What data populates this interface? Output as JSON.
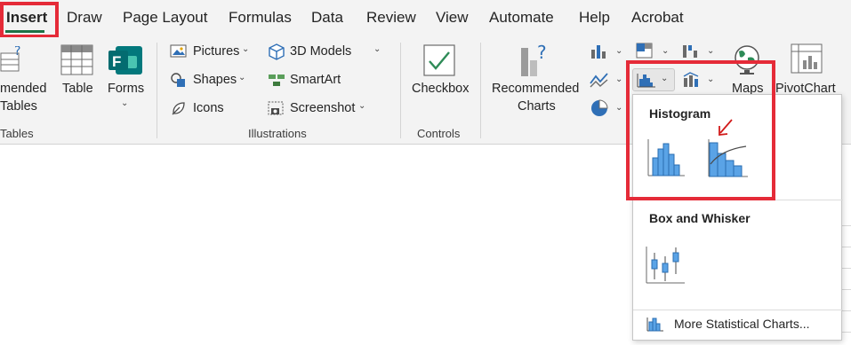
{
  "tabs": [
    {
      "label": "Insert"
    },
    {
      "label": "Draw"
    },
    {
      "label": "Page Layout"
    },
    {
      "label": "Formulas"
    },
    {
      "label": "Data"
    },
    {
      "label": "Review"
    },
    {
      "label": "View"
    },
    {
      "label": "Automate"
    },
    {
      "label": "Help"
    },
    {
      "label": "Acrobat"
    }
  ],
  "tables_group": {
    "recommended_line1": "mended",
    "recommended_line2": "Tables",
    "table": "Table",
    "forms": "Forms",
    "group_label": "Tables"
  },
  "illustrations": {
    "pictures": "Pictures",
    "shapes": "Shapes",
    "icons": "Icons",
    "models": "3D Models",
    "smartart": "SmartArt",
    "screenshot": "Screenshot",
    "group_label": "Illustrations"
  },
  "controls": {
    "checkbox": "Checkbox",
    "group_label": "Controls"
  },
  "charts": {
    "recommended_line1": "Recommended",
    "recommended_line2": "Charts",
    "maps": "Maps",
    "pivotchart": "PivotChart"
  },
  "statistic_menu": {
    "histogram_header": "Histogram",
    "box_whisker_header": "Box and Whisker",
    "more": "More Statistical Charts..."
  },
  "colors": {
    "accent_green": "#1e7145",
    "highlight_red": "#e52b38",
    "chart_blue": "#4a90d9",
    "arrow_red": "#d11a1a"
  }
}
